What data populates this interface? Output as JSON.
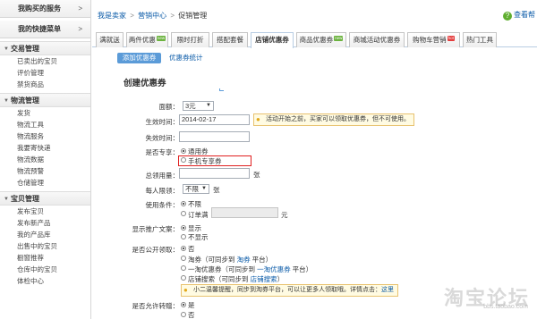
{
  "sidebar": {
    "top_items": [
      {
        "label": "我购买的服务",
        "arrow": ">"
      },
      {
        "label": "我的快捷菜单",
        "arrow": ">"
      }
    ],
    "groups": [
      {
        "title": "交易管理",
        "items": [
          "已卖出的宝贝",
          "评价管理",
          "禁货商品"
        ]
      },
      {
        "title": "物流管理",
        "items": [
          "发货",
          "物流工具",
          "物流服务",
          "我要寄快递",
          "物流数据",
          "物流预警",
          "仓储管理"
        ]
      },
      {
        "title": "宝贝管理",
        "items": [
          "发布宝贝",
          "发布新产品",
          "我的产品库",
          "出售中的宝贝",
          "橱窗推荐",
          "仓库中的宝贝",
          "体检中心"
        ]
      }
    ]
  },
  "breadcrumb": {
    "root": "我是卖家",
    "middle": "营销中心",
    "current": "促销管理",
    "separator": ">"
  },
  "help": {
    "icon": "?",
    "label": "查看帮"
  },
  "tabs": [
    {
      "label": "满就送",
      "badge": ""
    },
    {
      "label": "两件优惠",
      "badge": "new"
    },
    {
      "label": "限时打折",
      "badge": ""
    },
    {
      "label": "搭配套餐",
      "badge": ""
    },
    {
      "label": "店铺优惠券",
      "badge": "",
      "active": true
    },
    {
      "label": "商品优惠券",
      "badge": "new"
    },
    {
      "label": "商城活动优惠券",
      "badge": ""
    },
    {
      "label": "购物车营销",
      "badge": "hot"
    },
    {
      "label": "热门工具",
      "badge": ""
    }
  ],
  "subtabs": {
    "active": "添加优惠券",
    "other": "优惠券统计"
  },
  "form": {
    "title": "创建优惠券",
    "denomination": {
      "label": "面额：",
      "value": "3元"
    },
    "start_time": {
      "label": "生效时间：",
      "value": "2014-02-17",
      "hint": "活动开始之前，买家可以领取优惠券，但不可使用。"
    },
    "end_time": {
      "label": "失效时间：",
      "value": ""
    },
    "exclusive": {
      "label": "是否专享：",
      "options": [
        "通用券",
        "手机专享券"
      ]
    },
    "total": {
      "label": "总领用量：",
      "unit": "张"
    },
    "per_person": {
      "label": "每人限领：",
      "value": "不限",
      "unit": "张"
    },
    "condition": {
      "label": "使用条件：",
      "options": [
        "不限",
        "订单满"
      ],
      "unit": "元"
    },
    "promo_text": {
      "label": "显示推广文案：",
      "options": [
        "显示",
        "不显示"
      ]
    },
    "public": {
      "label": "是否公开领取：",
      "options": [
        "否",
        "淘券（可同步到",
        "一淘优惠券（可同步到",
        "店铺搜索（可同步到"
      ],
      "links": [
        "淘券",
        "一淘优惠券",
        "店铺搜索"
      ],
      "suffixes": [
        " 平台）",
        " 平台）",
        "）"
      ],
      "hint": "小二温馨提醒，同步到淘券平台，可以让更多人领取哦。详情点击：",
      "hint_link": "这里"
    },
    "transfer": {
      "label": "是否允许转赠：",
      "options": [
        "是",
        "否"
      ]
    }
  },
  "watermark": {
    "main": "淘宝论坛",
    "sub": "bbs.taobao.com"
  },
  "colors": {
    "accent": "#5b9bd8",
    "link": "#0b5ba8",
    "highlight_border": "#e02020",
    "hint_bg": "#fffbe2"
  }
}
